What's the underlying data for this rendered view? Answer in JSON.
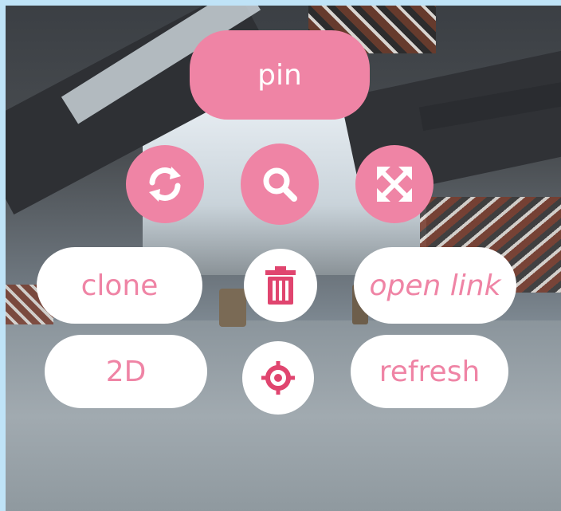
{
  "menu": {
    "pin_label": "pin",
    "clone_label": "clone",
    "open_link_label": "open link",
    "two_d_label": "2D",
    "refresh_label": "refresh"
  },
  "icons": {
    "rotate": "rotate-icon",
    "search": "search-icon",
    "expand": "expand-icon",
    "trash": "trash-icon",
    "target": "crosshair-icon"
  },
  "colors": {
    "accent": "#ef84a5",
    "button_text_light": "#ffffff",
    "button_bg_light": "#ffffff",
    "icon_dark_pink": "#e0456f"
  }
}
